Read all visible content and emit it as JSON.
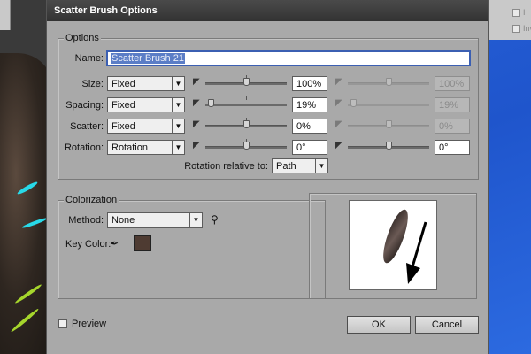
{
  "dialog": {
    "title": "Scatter Brush Options"
  },
  "options": {
    "group_title": "Options",
    "name_label": "Name:",
    "name_value": "Scatter Brush 21",
    "rows": [
      {
        "label": "Size:",
        "method": "Fixed",
        "value1": "100%",
        "value2": "100%",
        "slider1_level": 0.5,
        "slider2_level": 0.5,
        "secondary_disabled": true
      },
      {
        "label": "Spacing:",
        "method": "Fixed",
        "value1": "19%",
        "value2": "19%",
        "slider1_level": 0.07,
        "slider2_level": 0.07,
        "secondary_disabled": true
      },
      {
        "label": "Scatter:",
        "method": "Fixed",
        "value1": "0%",
        "value2": "0%",
        "slider1_level": 0.5,
        "slider2_level": 0.5,
        "secondary_disabled": true
      },
      {
        "label": "Rotation:",
        "method": "Rotation",
        "value1": "0°",
        "value2": "0°",
        "slider1_level": 0.5,
        "slider2_level": 0.5,
        "secondary_disabled": false
      }
    ],
    "rotation_relative_label": "Rotation relative to:",
    "rotation_relative_value": "Path"
  },
  "colorization": {
    "group_title": "Colorization",
    "method_label": "Method:",
    "method_value": "None",
    "key_color_label": "Key Color:",
    "key_color": "#4e3b32",
    "tips_icon": "lightbulb-icon",
    "eyedropper_icon": "eyedropper-icon"
  },
  "preview": {
    "checkbox_label": "Preview",
    "checked": false
  },
  "buttons": {
    "ok": "OK",
    "cancel": "Cancel"
  },
  "background_panel": {
    "items": [
      "I",
      "Inv"
    ]
  },
  "colors": {
    "dialog_bg": "#a9a9a9",
    "titlebar": "#3c3c3c",
    "selection": "#5b7dc6",
    "desktop_blue": "#2560d8"
  }
}
